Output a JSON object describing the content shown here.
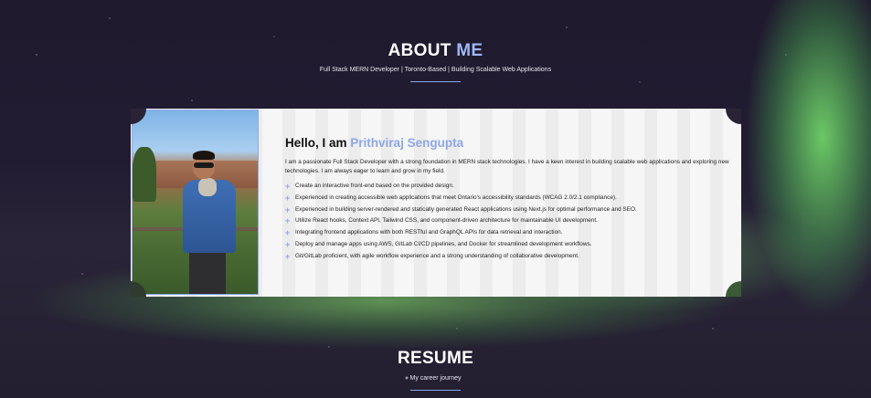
{
  "about": {
    "title_main": "ABOUT",
    "title_accent": "ME",
    "subtitle": "Full Stack MERN Developer | Toronto-Based | Building Scalable Web Applications"
  },
  "card": {
    "greeting": "Hello, I am",
    "name": "Prithviraj Sengupta",
    "intro": "I am a passionate Full Stack Developer with a strong foundation in MERN stack technologies. I have a keen interest in building scalable web applications and exploring new technologies. I am always eager to learn and grow in my field.",
    "bullet_icon": "plus-icon",
    "skills": [
      "Create an interactive front-end based on the provided design.",
      "Experienced in creating accessible web applications that meet Ontario's accessibility standards (WCAG 2.0/2.1 compliance).",
      "Experienced in building server-rendered and statically generated React applications using Next.js for optimal performance and SEO.",
      "Utilize React hooks, Context API, Tailwind CSS, and component-driven architecture for maintainable UI development.",
      "Integrating frontend applications with both RESTful and GraphQL APIs for data retrieval and interaction.",
      "Deploy and manage apps using AWS, GitLab CI/CD pipelines, and Docker for streamlined development workflows.",
      "Git/GitLab proficient, with agile workflow experience and a strong understanding of collaborative development."
    ]
  },
  "resume": {
    "title": "RESUME",
    "subtitle": "My career journey"
  },
  "colors": {
    "accent": "#8ea6e8",
    "card_bg": "#f6f6f6",
    "text": "#ffffff"
  }
}
